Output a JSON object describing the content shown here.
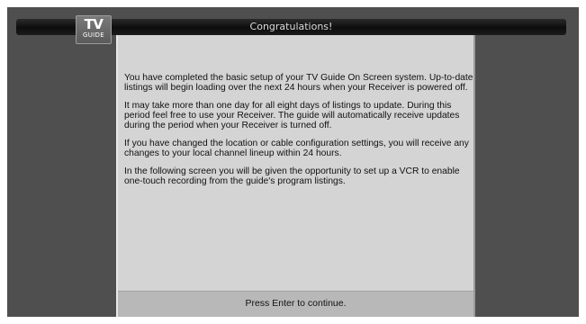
{
  "header": {
    "title": "Congratulations!",
    "logo": {
      "line1": "TV",
      "line2": "GUIDE"
    }
  },
  "content": {
    "paragraphs": [
      "You have completed the basic setup of your TV Guide On Screen system.  Up-to-date listings will begin loading over the next 24 hours when your Receiver is powered off.",
      "It may take more than one day for all eight days of listings to update.  During this period feel free to use your Receiver.  The guide will automatically receive updates during the period when your Receiver is turned off.",
      "If you have changed the location or cable configuration settings, you will receive any changes to your local channel lineup within 24 hours.",
      "In the following screen you will be given the opportunity to set up a VCR to enable one-touch recording from the guide's program listings."
    ]
  },
  "footer": {
    "prompt": "Press Enter to continue."
  },
  "colors": {
    "screen_background": "#4f4f4f",
    "panel_background": "#d4d4d4",
    "title_bar": "#111111",
    "footer_bar": "#b8b8b8"
  }
}
